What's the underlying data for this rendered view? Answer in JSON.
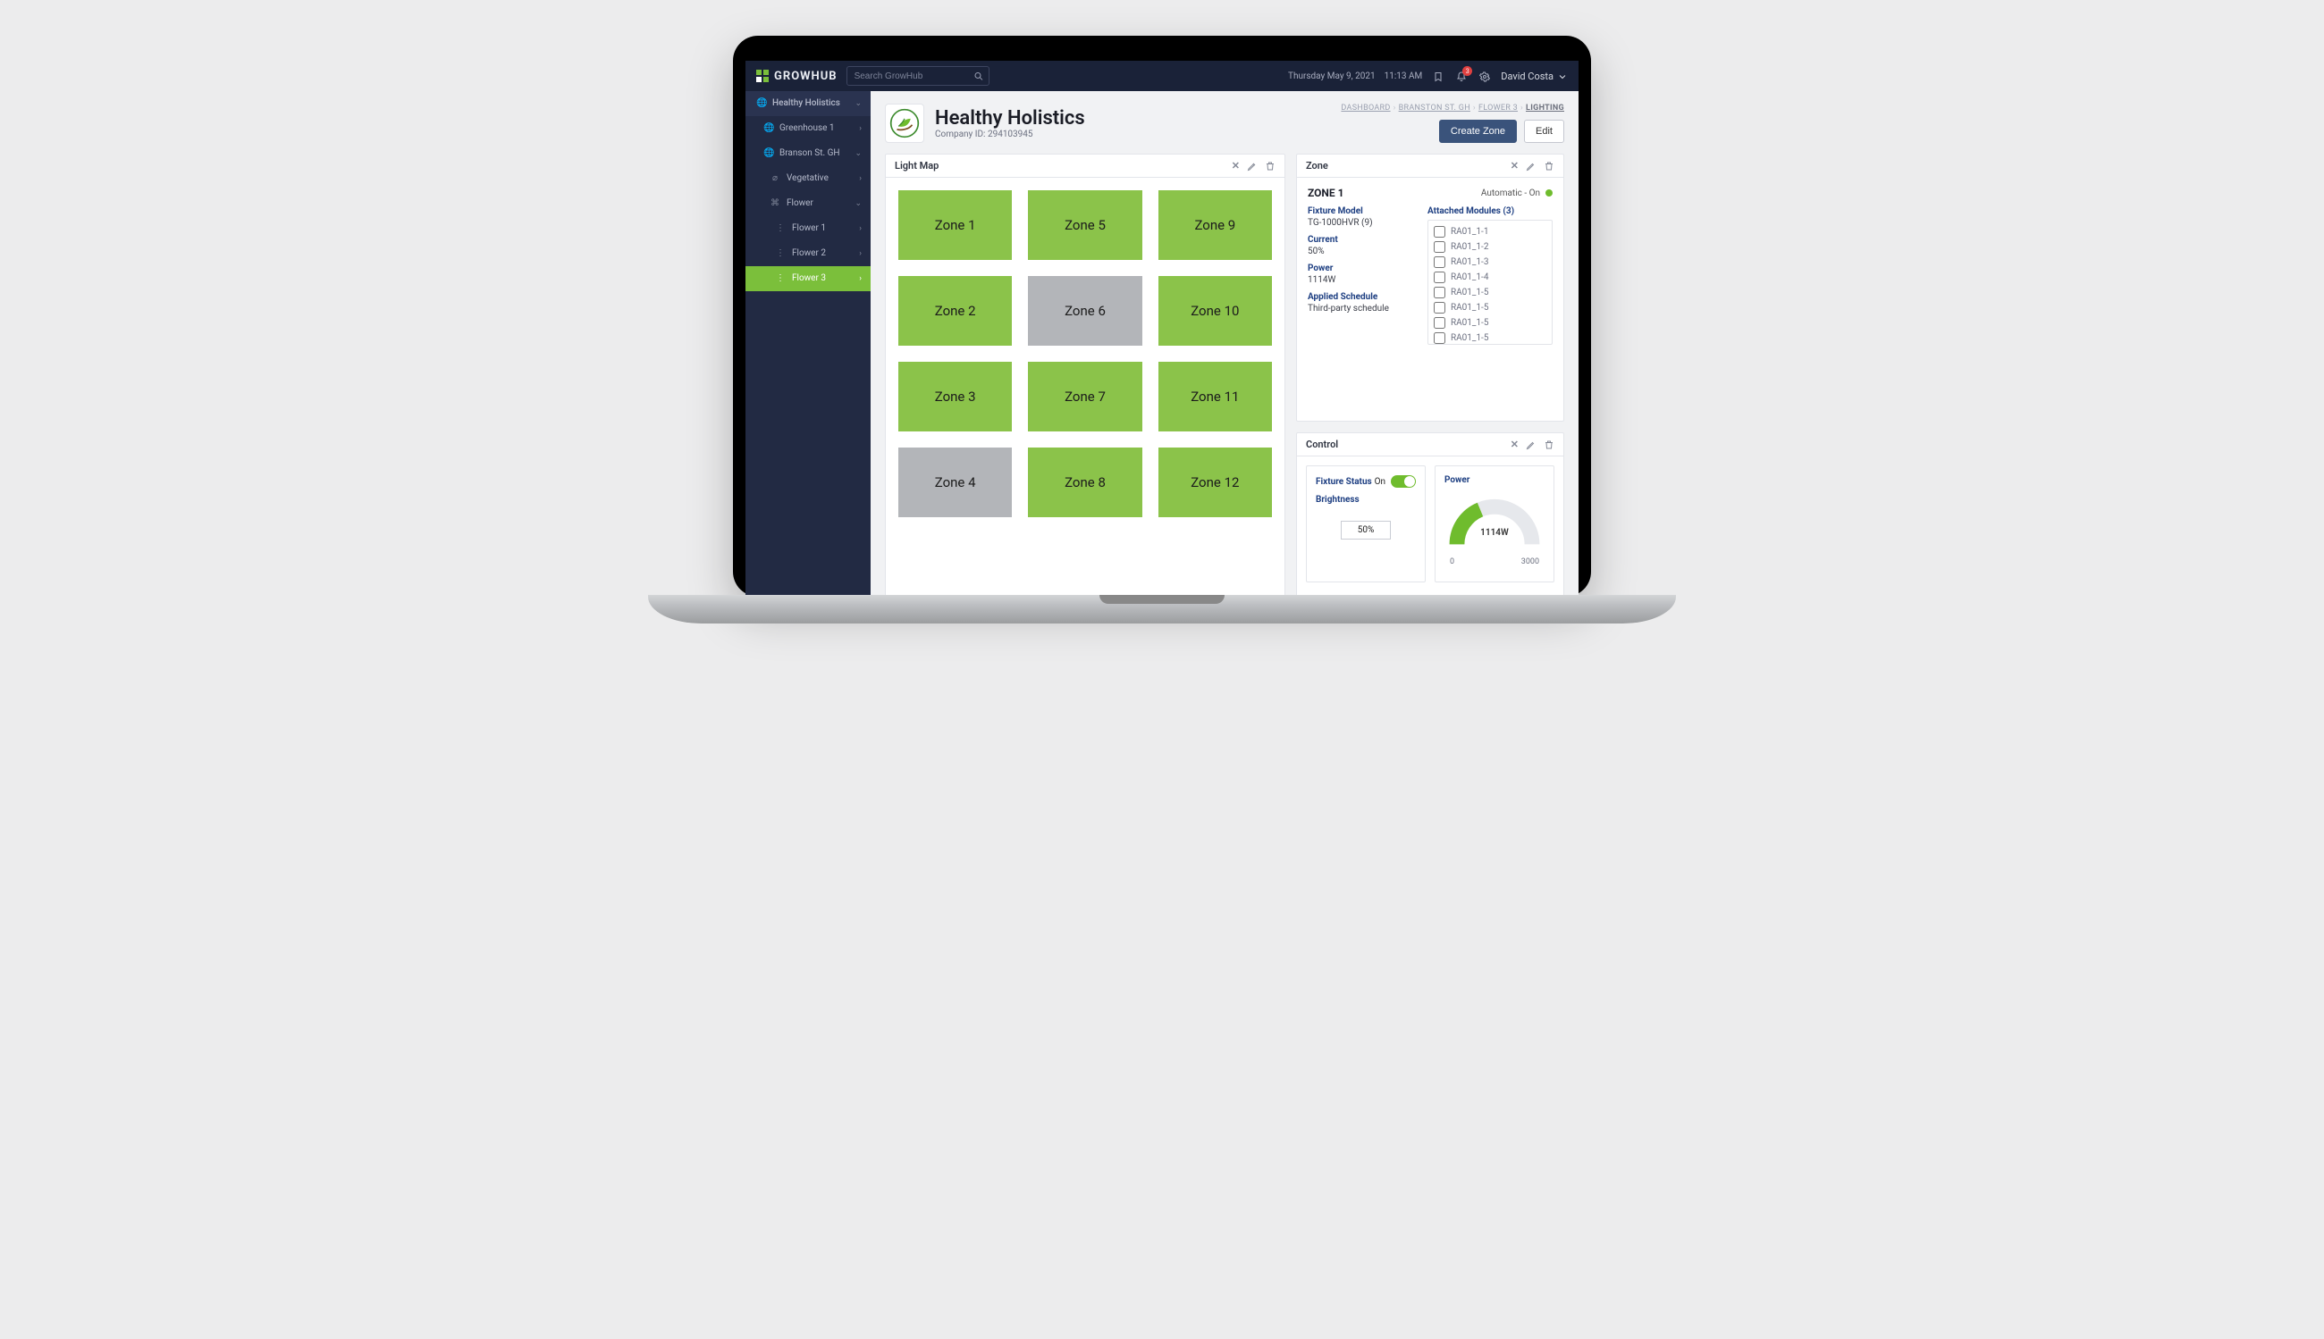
{
  "header": {
    "app_name": "GROWHUB",
    "search_placeholder": "Search GrowHub",
    "date": "Thursday May 9, 2021",
    "time": "11:13 AM",
    "notification_count": "3",
    "user_name": "David Costa"
  },
  "sidebar": [
    {
      "label": "Healthy Holistics",
      "level": 0,
      "icon": "globe",
      "caret": "down",
      "active": false
    },
    {
      "label": "Greenhouse 1",
      "level": 1,
      "icon": "globe",
      "caret": "right",
      "active": false
    },
    {
      "label": "Branson St. GH",
      "level": 1,
      "icon": "globe",
      "caret": "down",
      "active": false
    },
    {
      "label": "Vegetative",
      "level": 2,
      "icon": "leaf",
      "caret": "right",
      "active": false
    },
    {
      "label": "Flower",
      "level": 2,
      "icon": "grid",
      "caret": "down",
      "active": false
    },
    {
      "label": "Flower 1",
      "level": 3,
      "icon": "dots",
      "caret": "right",
      "active": false
    },
    {
      "label": "Flower 2",
      "level": 3,
      "icon": "dots",
      "caret": "right",
      "active": false
    },
    {
      "label": "Flower 3",
      "level": 3,
      "icon": "dots",
      "caret": "right",
      "active": true
    }
  ],
  "breadcrumbs": [
    "DASHBOARD",
    "BRANSTON ST. GH",
    "FLOWER 3",
    "LIGHTING"
  ],
  "page": {
    "title": "Healthy Holistics",
    "subtitle": "Company ID: 294103945",
    "create_label": "Create Zone",
    "edit_label": "Edit"
  },
  "panels": {
    "lightmap_title": "Light Map",
    "zone_title": "Zone",
    "control_title": "Control"
  },
  "zones": [
    {
      "label": "Zone 1",
      "off": false
    },
    {
      "label": "Zone 5",
      "off": false
    },
    {
      "label": "Zone 9",
      "off": false
    },
    {
      "label": "Zone 2",
      "off": false
    },
    {
      "label": "Zone 6",
      "off": true
    },
    {
      "label": "Zone 10",
      "off": false
    },
    {
      "label": "Zone 3",
      "off": false
    },
    {
      "label": "Zone 7",
      "off": false
    },
    {
      "label": "Zone 11",
      "off": false
    },
    {
      "label": "Zone 4",
      "off": true
    },
    {
      "label": "Zone 8",
      "off": false
    },
    {
      "label": "Zone 12",
      "off": false
    }
  ],
  "zone_detail": {
    "name": "ZONE 1",
    "status_text": "Automatic - On",
    "labels": {
      "fixture_model": "Fixture Model",
      "current": "Current",
      "power": "Power",
      "schedule": "Applied Schedule",
      "modules": "Attached Modules (3)"
    },
    "fixture_model": "TG-1000HVR (9)",
    "current": "50%",
    "power": "1114W",
    "schedule": "Third-party schedule",
    "modules": [
      "RA01_1-1",
      "RA01_1-2",
      "RA01_1-3",
      "RA01_1-4",
      "RA01_1-5",
      "RA01_1-5",
      "RA01_1-5",
      "RA01_1-5"
    ]
  },
  "control": {
    "fixture_status_label": "Fixture Status",
    "fixture_status_value": "On",
    "brightness_label": "Brightness",
    "brightness_value": "50%",
    "power_label": "Power",
    "power_value": "1114W",
    "power_min": "0",
    "power_max": "3000"
  }
}
